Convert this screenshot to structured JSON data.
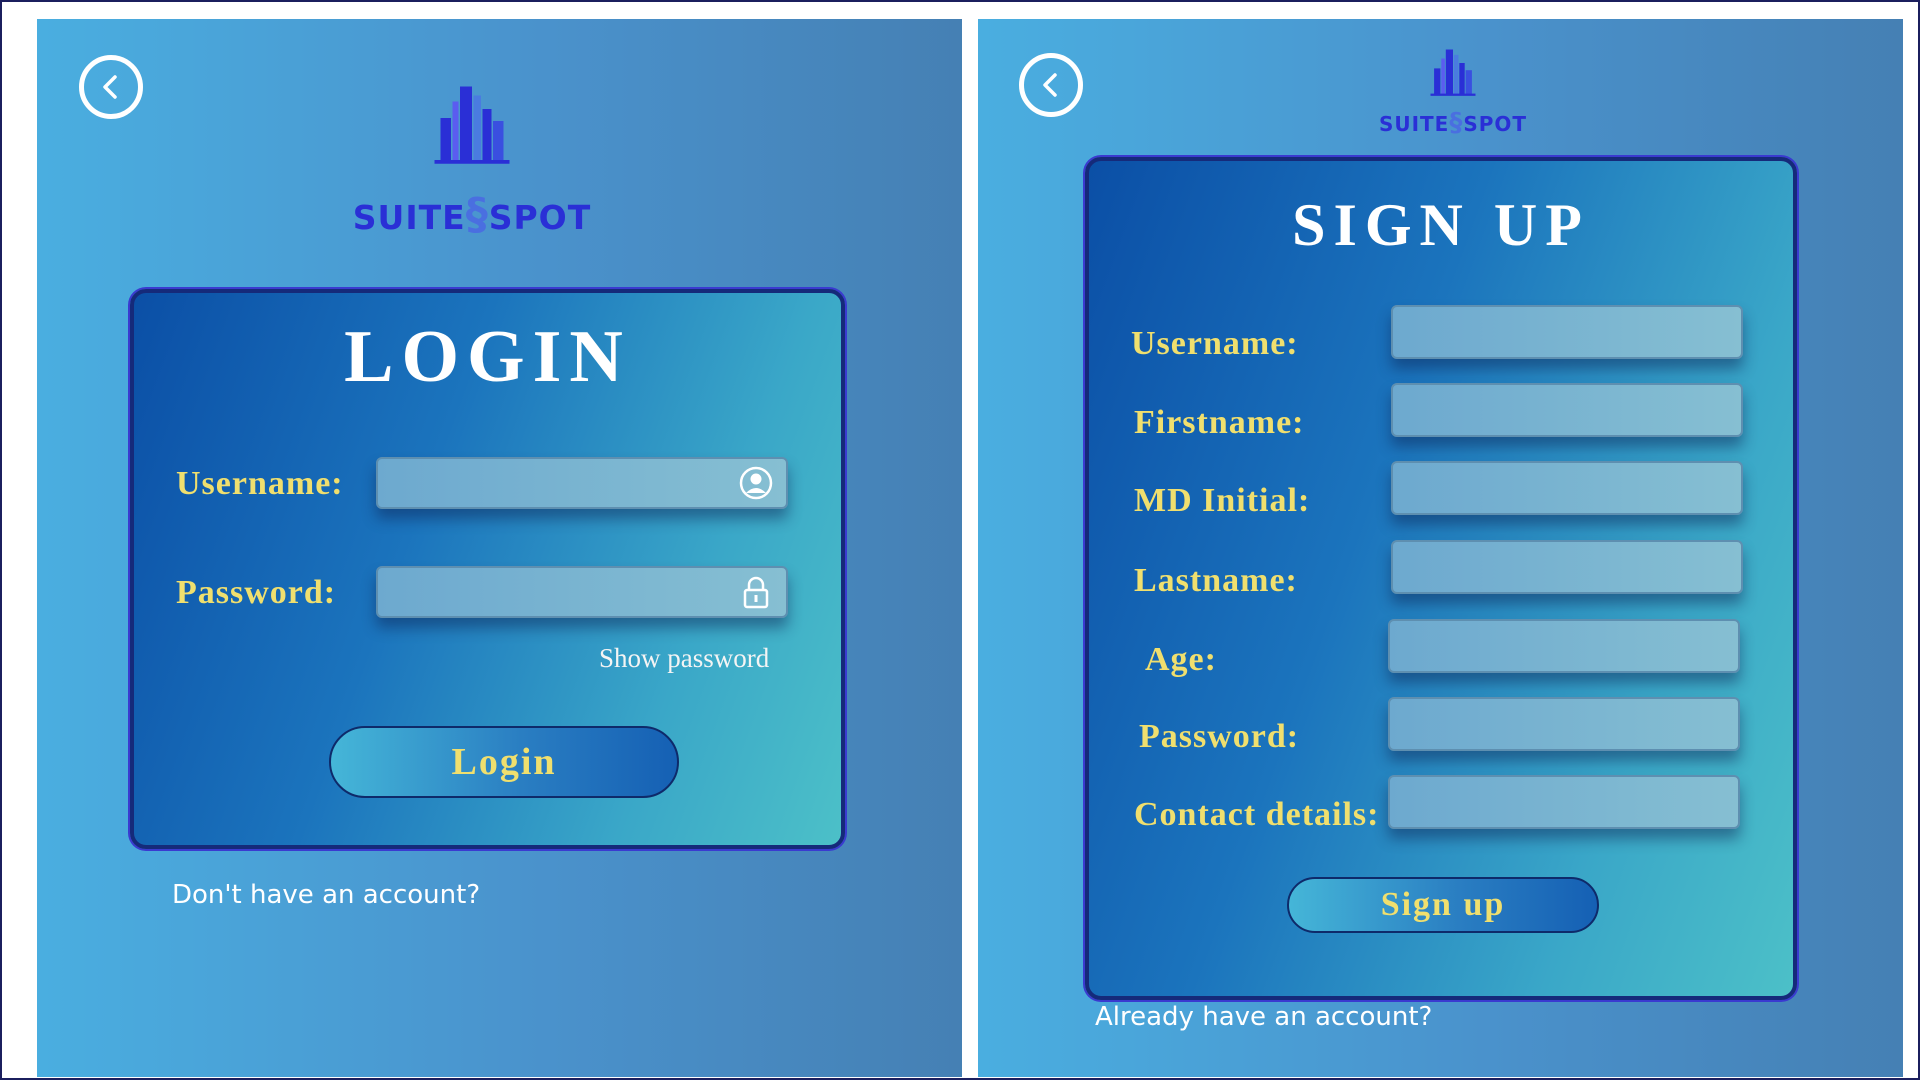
{
  "brand": {
    "name_left": "SUITE",
    "name_right": "SPOT",
    "color": "#2a2fd6"
  },
  "login": {
    "title": "LOGIN",
    "username_label": "Username:",
    "password_label": "Password:",
    "username_value": "",
    "password_value": "",
    "username_icon": "user-circle-icon",
    "password_icon": "lock-icon",
    "show_password": "Show password",
    "login_button": "Login",
    "account_link": "Don't have an account?"
  },
  "signup": {
    "title": "SIGN UP",
    "fields": [
      {
        "label": "Username:",
        "value": ""
      },
      {
        "label": "Firstname:",
        "value": ""
      },
      {
        "label": "MD Initial:",
        "value": ""
      },
      {
        "label": "Lastname:",
        "value": ""
      },
      {
        "label": "Age:",
        "value": ""
      },
      {
        "label": "Password:",
        "value": ""
      },
      {
        "label": "Contact details:",
        "value": ""
      }
    ],
    "signup_button": "Sign up",
    "account_link": "Already have an account?"
  },
  "colors": {
    "label_gold": "#f0df6e",
    "card_border": "#152a7a",
    "back_icon": "#ffffff"
  },
  "icons": {
    "back": "chevron-left-circle-icon",
    "logo": "building-skyline-icon"
  }
}
